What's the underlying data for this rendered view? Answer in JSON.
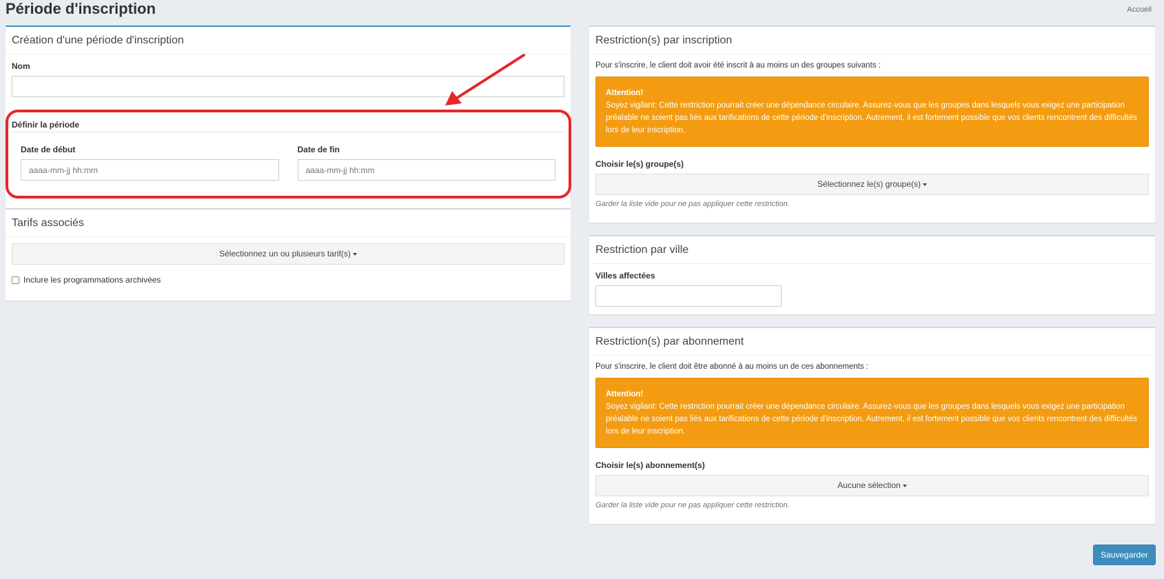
{
  "page": {
    "title": "Période d'inscription",
    "breadcrumb": "Accueil"
  },
  "creation": {
    "header": "Création d'une période d'inscription",
    "name_label": "Nom",
    "name_value": "",
    "period_title": "Définir la période",
    "start_label": "Date de début",
    "start_placeholder": "aaaa-mm-jj hh:mm",
    "end_label": "Date de fin",
    "end_placeholder": "aaaa-mm-jj hh:mm"
  },
  "tarifs": {
    "header": "Tarifs associés",
    "select_label": "Sélectionnez un ou plusieurs tarif(s)",
    "archived_label": "Inclure les programmations archivées",
    "archived_checked": false
  },
  "restriction_inscription": {
    "header": "Restriction(s) par inscription",
    "intro": "Pour s'inscrire, le client doit avoir été inscrit à au moins un des groupes suivants :",
    "alert_title": "Attention!",
    "alert_body": "Soyez vigilant: Cette restriction pourrait créer une dépendance circulaire. Assurez-vous que les groupes dans lesquels vous exigez une participation préalable ne soient pas liés aux tarifications de cette période d'inscription. Autrement, il est fortement possible que vos clients rencontrent des difficultés lors de leur inscription.",
    "choose_label": "Choisir le(s) groupe(s)",
    "select_label": "Sélectionnez le(s) groupe(s)",
    "help": "Garder la liste vide pour ne pas appliquer cette restriction."
  },
  "restriction_ville": {
    "header": "Restriction par ville",
    "cities_label": "Villes affectées",
    "cities_value": ""
  },
  "restriction_abonnement": {
    "header": "Restriction(s) par abonnement",
    "intro": "Pour s'inscrire, le client doit être abonné à au moins un de ces abonnements :",
    "alert_title": "Attention!",
    "alert_body": "Soyez vigilant: Cette restriction pourrait créer une dépendance circulaire. Assurez-vous que les groupes dans lesquels vous exigez une participation préalable ne soient pas liés aux tarifications de cette période d'inscription. Autrement, il est fortement possible que vos clients rencontrent des difficultés lors de leur inscription.",
    "choose_label": "Choisir le(s) abonnement(s)",
    "select_label": "Aucune sélection",
    "help": "Garder la liste vide pour ne pas appliquer cette restriction."
  },
  "actions": {
    "save_label": "Sauvegarder"
  },
  "colors": {
    "primary": "#3c8dbc",
    "warning": "#f39c12",
    "annotation": "#e8262a",
    "background": "#e9edf1"
  }
}
